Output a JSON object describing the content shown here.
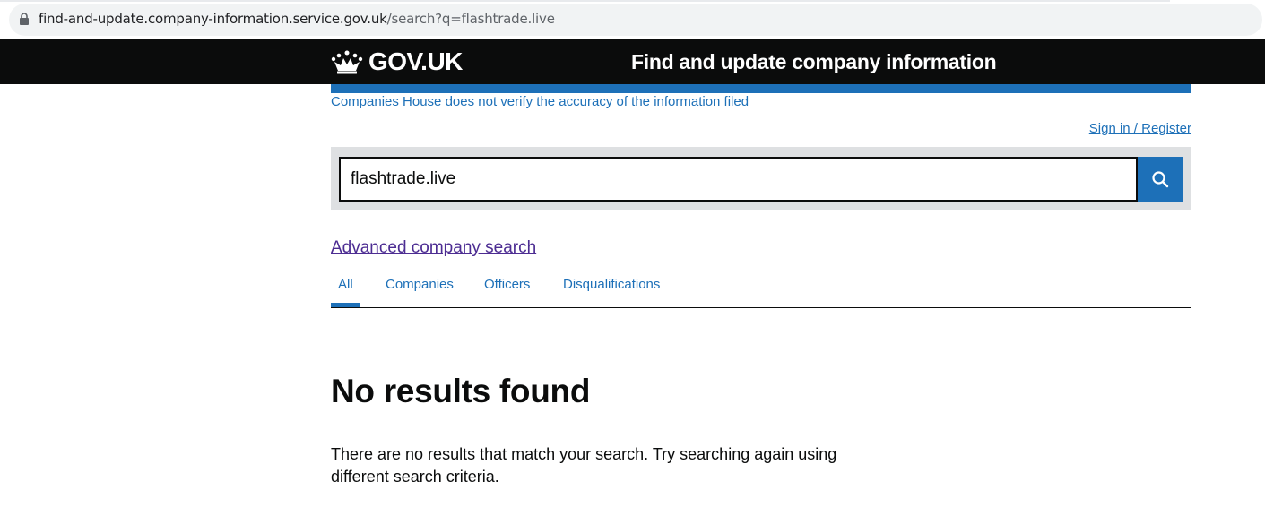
{
  "browser": {
    "url_host": "find-and-update.company-information.service.gov.uk",
    "url_path": "/search?q=flashtrade.live"
  },
  "header": {
    "logotype": "GOV.UK",
    "service_name": "Find and update company information"
  },
  "links": {
    "disclaimer": "Companies House does not verify the accuracy of the information filed",
    "sign_in": "Sign in / Register",
    "advanced_search": "Advanced company search"
  },
  "search": {
    "value": "flashtrade.live",
    "button_icon": "search-icon"
  },
  "tabs": [
    {
      "label": "All",
      "selected": true
    },
    {
      "label": "Companies",
      "selected": false
    },
    {
      "label": "Officers",
      "selected": false
    },
    {
      "label": "Disqualifications",
      "selected": false
    }
  ],
  "results": {
    "heading": "No results found",
    "message": "There are no results that match your search. Try searching again using different search criteria."
  },
  "colors": {
    "header_bg": "#0b0c0c",
    "brand_blue": "#1d70b8",
    "visited_link": "#4c2c92",
    "search_panel_bg": "#dee0e2"
  }
}
